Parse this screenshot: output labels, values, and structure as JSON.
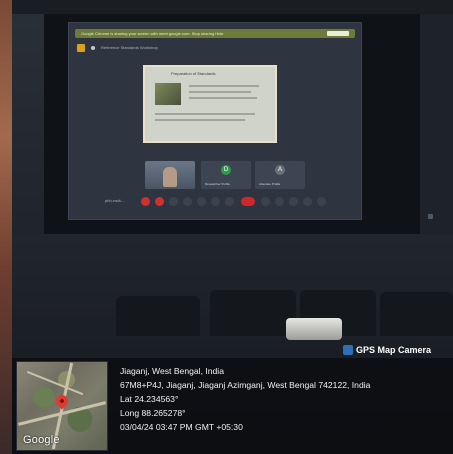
{
  "meeting": {
    "browser_notice": "Google Chrome is sharing your screen with meet.google.com. Stop sharing Hide",
    "meeting_title": "Reference Standards Workshop",
    "slide_title": "Preparation of Standards",
    "tiles": [
      {
        "type": "video",
        "name": ""
      },
      {
        "type": "avatar",
        "initial": "D",
        "name": "Researcher Profile"
      },
      {
        "type": "avatar",
        "initial": "A",
        "name": "Attendee Profile"
      }
    ],
    "controls_label": "pbh-rwdt-..."
  },
  "watermark": {
    "label": "GPS Map Camera",
    "icon": "map-camera-icon",
    "icon_color": "#2f6fb8"
  },
  "geotag": {
    "map_label": "Google",
    "place": "Jiaganj, West Bengal, India",
    "address": "67M8+P4J, Jiaganj, Jiaganj Azimganj, West Bengal 742122, India",
    "lat": "Lat 24.234563°",
    "long": "Long 88.265278°",
    "datetime": "03/04/24 03:47 PM GMT +05:30",
    "pin_color": "#e03a2f"
  }
}
